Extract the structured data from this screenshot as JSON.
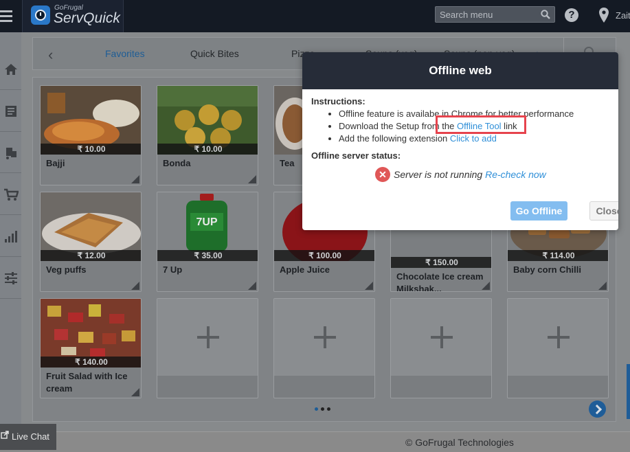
{
  "header": {
    "brand_small": "GoFrugal",
    "brand_big": "ServQuick",
    "search_placeholder": "Search menu",
    "location_text": "Zait"
  },
  "tabs": [
    "Favorites",
    "Quick Bites",
    "Pizza",
    "Soups (veg)",
    "Soups (non-veg)"
  ],
  "items": [
    {
      "name": "Bajji",
      "price": "₹ 10.00"
    },
    {
      "name": "Bonda",
      "price": "₹ 10.00"
    },
    {
      "name": "Tea",
      "price": ""
    },
    {
      "name": "Veg puffs",
      "price": "₹ 12.00"
    },
    {
      "name": "7 Up",
      "price": "₹ 35.00"
    },
    {
      "name": "Apple Juice",
      "price": "₹ 100.00"
    },
    {
      "name": "Chocolate Ice cream Milkshak...",
      "price": "₹ 150.00"
    },
    {
      "name": "Baby corn Chilli",
      "price": "₹ 114.00"
    },
    {
      "name": "Fruit Salad with Ice cream",
      "price": "₹ 140.00"
    }
  ],
  "modal": {
    "title": "Offline web",
    "instructions_title": "Instructions:",
    "line1": "Offline feature is availabe in Chrome for better performance",
    "line2_prefix": "Download the Setup from the ",
    "line2_link": "Offline Tool",
    "line2_suffix": " link",
    "line3_prefix": "Add the following extension ",
    "line3_link": "Click to add",
    "status_title": "Offline server status:",
    "status_text": "Server is not running ",
    "status_link": "Re-check now",
    "go_offline": "Go Offline",
    "close": "Close"
  },
  "footer": {
    "copyright": "© GoFrugal Technologies",
    "live_chat": "Live Chat"
  },
  "colors": {
    "header_bg": "#141a24",
    "accent_link": "#2f8fd8",
    "highlight": "#e6434d"
  }
}
